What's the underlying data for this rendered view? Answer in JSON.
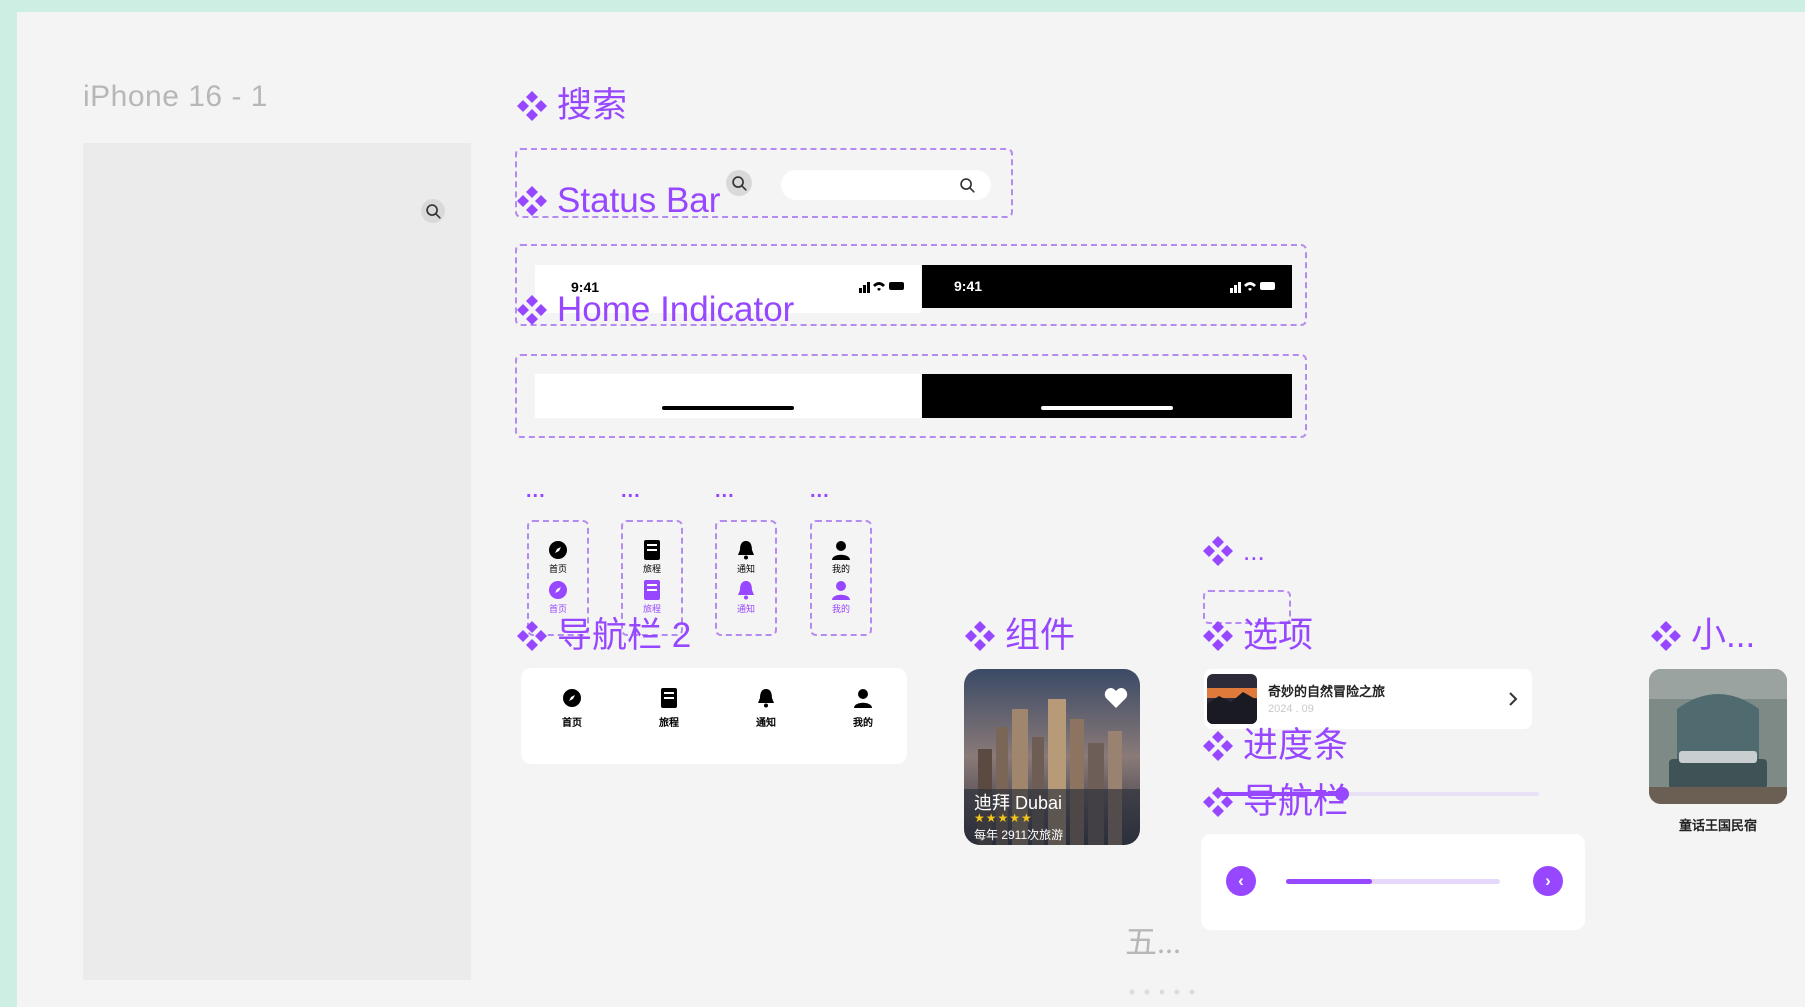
{
  "frame": {
    "title": "iPhone 16 - 1"
  },
  "labels": {
    "search": "搜索",
    "status_bar": "Status Bar",
    "home_indicator": "Home Indicator",
    "nav_bar_2": "导航栏 2",
    "component": "组件",
    "ellipsis_top": "...",
    "options": "选项",
    "progress": "进度条",
    "nav_bar": "导航栏",
    "small": "小...",
    "five": "五..."
  },
  "icons": {
    "component_icon": "component-diamond-icon",
    "search_icon": "search-icon",
    "status_icons": [
      "signal-icon",
      "wifi-icon",
      "battery-icon"
    ]
  },
  "status_bar": {
    "light_time": "9:41",
    "dark_time": "9:41"
  },
  "variant_dots": [
    "...",
    "...",
    "...",
    "..."
  ],
  "nav_variants": [
    {
      "icon": "compass-icon",
      "label": "首页"
    },
    {
      "icon": "document-icon",
      "label": "旅程"
    },
    {
      "icon": "bell-icon",
      "label": "通知"
    },
    {
      "icon": "user-icon",
      "label": "我的"
    }
  ],
  "tabbar": [
    {
      "icon": "compass-icon",
      "label": "首页"
    },
    {
      "icon": "document-icon",
      "label": "旅程"
    },
    {
      "icon": "bell-icon",
      "label": "通知"
    },
    {
      "icon": "user-icon",
      "label": "我的"
    }
  ],
  "card": {
    "title": "迪拜 Dubai",
    "stars": "★★★★★",
    "subtitle": "每年 2911次旅游",
    "icon": "heart-icon"
  },
  "option": {
    "title": "奇妙的自然冒险之旅",
    "date": "2024 . 09",
    "icon": "chevron-right-icon"
  },
  "progress": {
    "value": 0.38
  },
  "slider": {
    "prev_icon": "chevron-left-icon",
    "next_icon": "chevron-right-icon",
    "value": 0.4
  },
  "small_card": {
    "caption": "童话王国民宿"
  },
  "colors": {
    "accent": "#9747ff",
    "dashed": "#b48bf0",
    "canvas": "#f4f4f4",
    "frame": "#ebebeb",
    "border": "#cdeee3"
  }
}
